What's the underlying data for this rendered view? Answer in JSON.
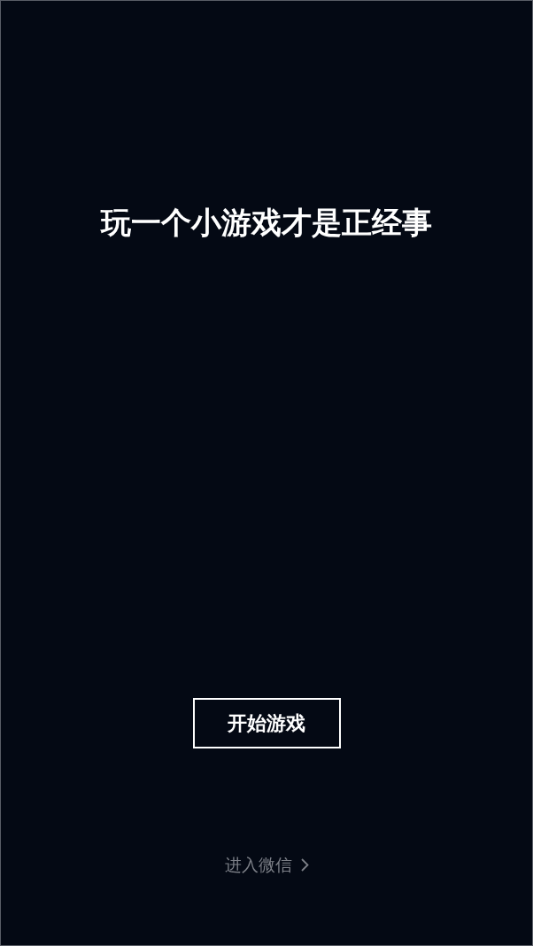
{
  "title": "玩一个小游戏才是正经事",
  "start_button": {
    "label": "开始游戏"
  },
  "footer_link": {
    "label": "进入微信"
  }
}
